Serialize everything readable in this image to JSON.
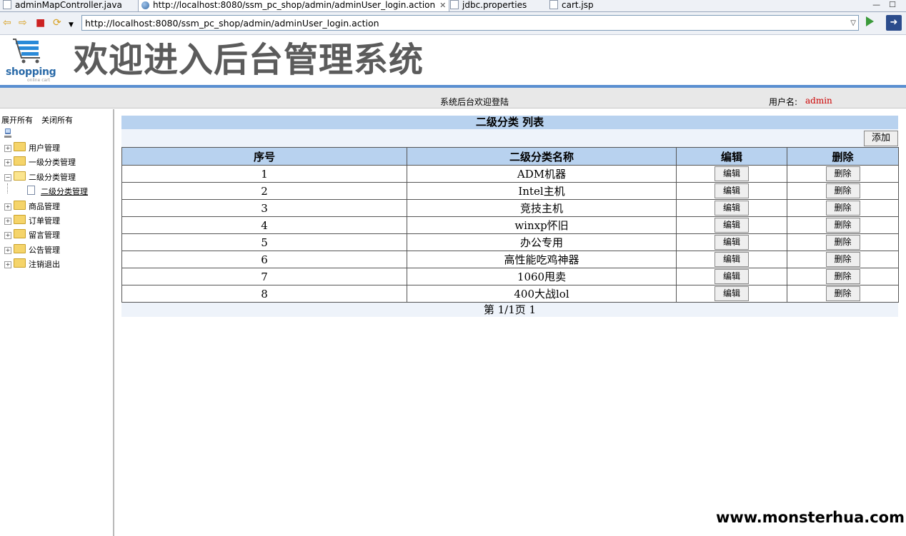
{
  "browser": {
    "tabs": [
      {
        "label": "adminMapController.java"
      },
      {
        "label": "http://localhost:8080/ssm_pc_shop/admin/adminUser_login.action"
      },
      {
        "label": "jdbc.properties"
      },
      {
        "label": "cart.jsp"
      }
    ],
    "url": "http://localhost:8080/ssm_pc_shop/admin/adminUser_login.action"
  },
  "header": {
    "logo_text": "shopping",
    "logo_sub": "online cart",
    "title": "欢迎进入后台管理系统"
  },
  "status": {
    "welcome": "系统后台欢迎登陆",
    "user_label": "用户名:",
    "username": "admin"
  },
  "sidebar": {
    "expand_all": "展开所有",
    "collapse_all": "关闭所有",
    "items": [
      {
        "label": "用户管理",
        "expanded": false
      },
      {
        "label": "一级分类管理",
        "expanded": false
      },
      {
        "label": "二级分类管理",
        "expanded": true
      },
      {
        "label": "二级分类管理"
      },
      {
        "label": "商品管理",
        "expanded": false
      },
      {
        "label": "订单管理",
        "expanded": false
      },
      {
        "label": "留言管理",
        "expanded": false
      },
      {
        "label": "公告管理",
        "expanded": false
      },
      {
        "label": "注销退出",
        "expanded": false
      }
    ]
  },
  "main": {
    "caption": "二级分类 列表",
    "add_label": "添加",
    "columns": [
      "序号",
      "二级分类名称",
      "编辑",
      "删除"
    ],
    "edit_label": "编辑",
    "delete_label": "删除",
    "rows": [
      {
        "id": "1",
        "name": "ADM机器"
      },
      {
        "id": "2",
        "name": "Intel主机"
      },
      {
        "id": "3",
        "name": "竞技主机"
      },
      {
        "id": "4",
        "name": "winxp怀旧"
      },
      {
        "id": "5",
        "name": "办公专用"
      },
      {
        "id": "6",
        "name": "高性能吃鸡神器"
      },
      {
        "id": "7",
        "name": "1060甩卖"
      },
      {
        "id": "8",
        "name": "400大战lol"
      }
    ],
    "pager": "第 1/1页 1"
  },
  "watermark": "www.monsterhua.com"
}
